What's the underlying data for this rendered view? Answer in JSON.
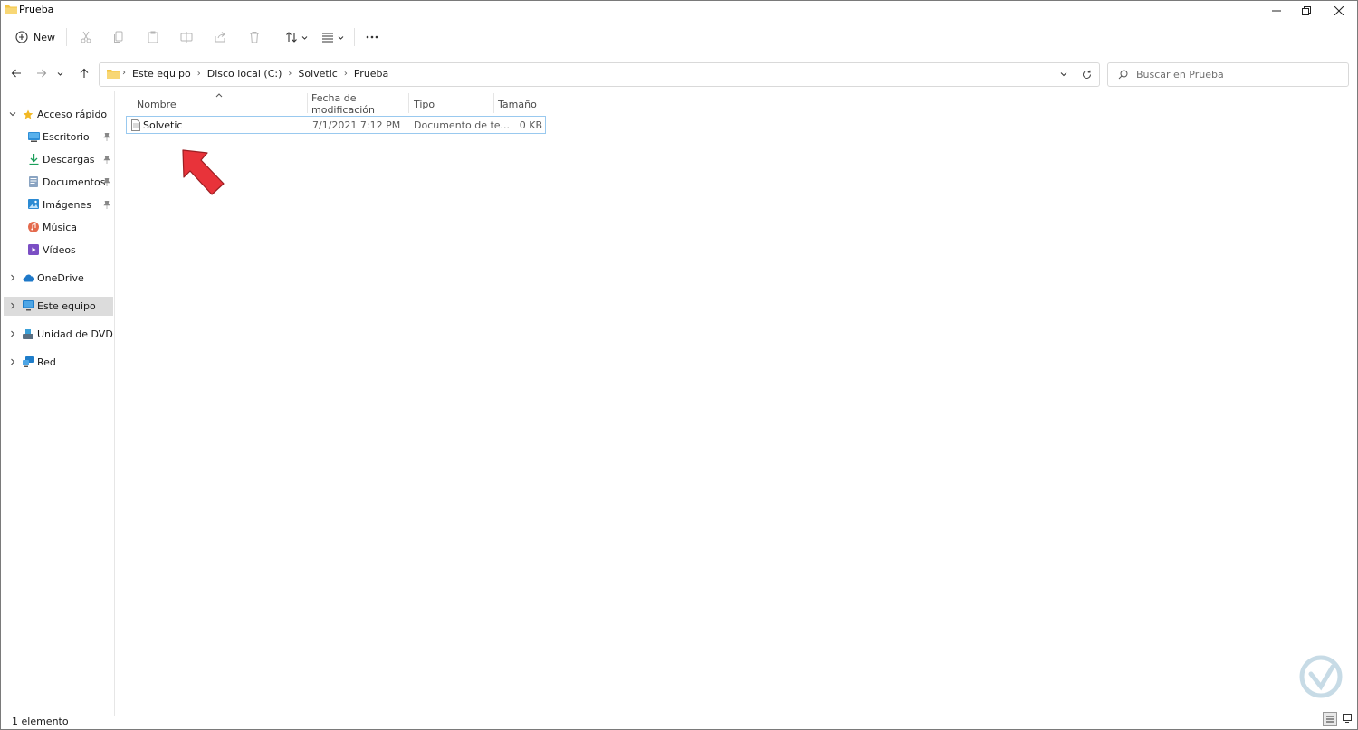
{
  "window": {
    "title": "Prueba"
  },
  "toolbar": {
    "new_label": "New"
  },
  "nav": {
    "breadcrumbs": [
      "Este equipo",
      "Disco local (C:)",
      "Solvetic",
      "Prueba"
    ],
    "search_placeholder": "Buscar en Prueba"
  },
  "sidebar": {
    "quick_access": "Acceso rápido",
    "items": [
      {
        "label": "Escritorio",
        "icon": "desktop-icon"
      },
      {
        "label": "Descargas",
        "icon": "download-icon"
      },
      {
        "label": "Documentos",
        "icon": "documents-icon"
      },
      {
        "label": "Imágenes",
        "icon": "pictures-icon"
      },
      {
        "label": "Música",
        "icon": "music-icon"
      },
      {
        "label": "Vídeos",
        "icon": "videos-icon"
      }
    ],
    "onedrive": "OneDrive",
    "this_pc": "Este equipo",
    "dvd": "Unidad de DVD (D:) C",
    "network": "Red"
  },
  "columns": {
    "name": "Nombre",
    "date": "Fecha de modificación",
    "type": "Tipo",
    "size": "Tamaño"
  },
  "files": [
    {
      "name": "Solvetic",
      "date": "7/1/2021 7:12 PM",
      "type": "Documento de te...",
      "size": "0 KB"
    }
  ],
  "status": {
    "count": "1 elemento"
  },
  "colors": {
    "accent": "#0067c0",
    "arrow": "#e8333a",
    "folder": "#f4c542"
  }
}
